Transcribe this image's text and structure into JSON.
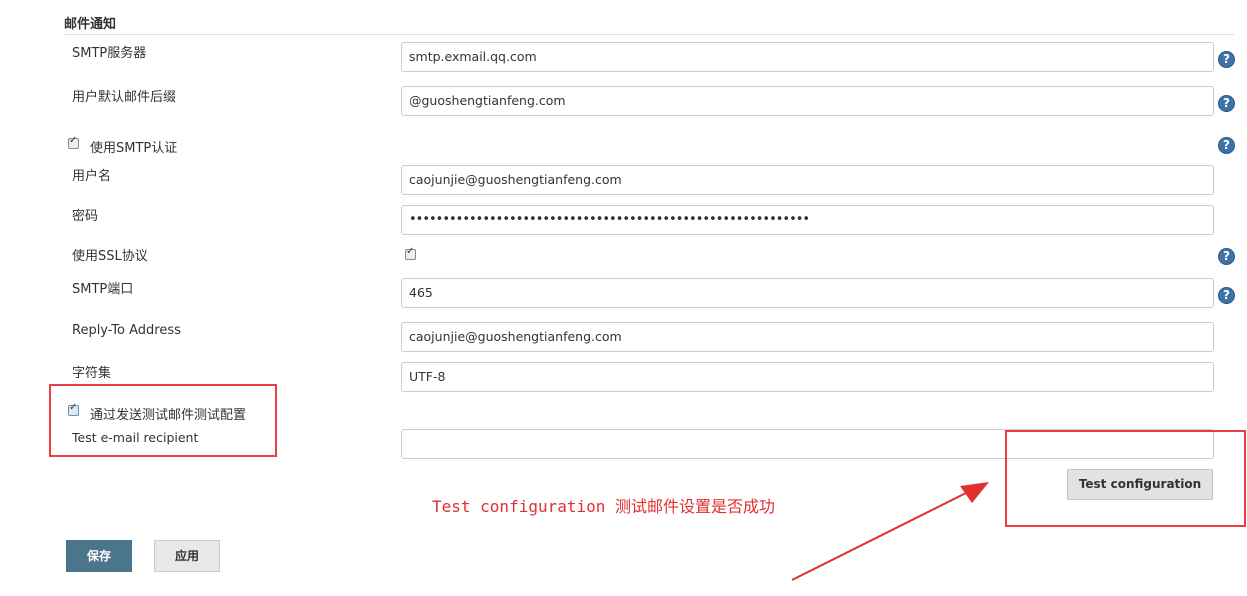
{
  "section": {
    "title": "邮件通知"
  },
  "smtp_server": {
    "label": "SMTP服务器",
    "value": "smtp.exmail.qq.com"
  },
  "default_suffix": {
    "label": "用户默认邮件后缀",
    "value": "@guoshengtianfeng.com"
  },
  "smtp_auth": {
    "label": "使用SMTP认证",
    "checked": true
  },
  "username": {
    "label": "用户名",
    "value": "caojunjie@guoshengtianfeng.com"
  },
  "password": {
    "label": "密码",
    "value": "••••••••••••••••••••••••••••••••••••••••••••••••••••••••••••"
  },
  "ssl": {
    "label": "使用SSL协议",
    "checked": true
  },
  "smtp_port": {
    "label": "SMTP端口",
    "value": "465"
  },
  "reply_to": {
    "label": "Reply-To Address",
    "value": "caojunjie@guoshengtianfeng.com"
  },
  "charset": {
    "label": "字符集",
    "value": "UTF-8"
  },
  "test_mail": {
    "label": "通过发送测试邮件测试配置",
    "checked": true
  },
  "test_recipient": {
    "label": "Test e-mail recipient",
    "value": ""
  },
  "buttons": {
    "test": "Test configuration",
    "save": "保存",
    "apply": "应用"
  },
  "annotation": {
    "text": "Test configuration 测试邮件设置是否成功",
    "color": "#e03030"
  },
  "help_icon": {
    "glyph": "?",
    "icon": "help-icon"
  },
  "colors": {
    "save_button": "#4b758b",
    "help": "#3f73a8",
    "highlight": "#e84040"
  }
}
